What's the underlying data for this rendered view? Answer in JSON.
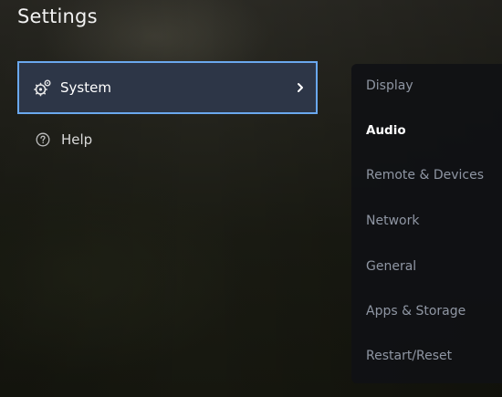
{
  "page": {
    "title": "Settings"
  },
  "left_menu": {
    "items": [
      {
        "label": "System",
        "icon": "gear-icon",
        "selected": true,
        "chevron": "chevron-right-icon"
      },
      {
        "label": "Help",
        "icon": "help-circle-icon",
        "selected": false
      }
    ]
  },
  "submenu": {
    "items": [
      {
        "label": "Display"
      },
      {
        "label": "Audio",
        "active": true
      },
      {
        "label": "Remote & Devices"
      },
      {
        "label": "Network"
      },
      {
        "label": "General"
      },
      {
        "label": "Apps & Storage"
      },
      {
        "label": "Restart/Reset"
      }
    ]
  },
  "colors": {
    "focus_border": "#6aa8ee",
    "selected_bg": "#2d3647",
    "submenu_text": "#8f96a3",
    "active_text": "#ffffff"
  }
}
